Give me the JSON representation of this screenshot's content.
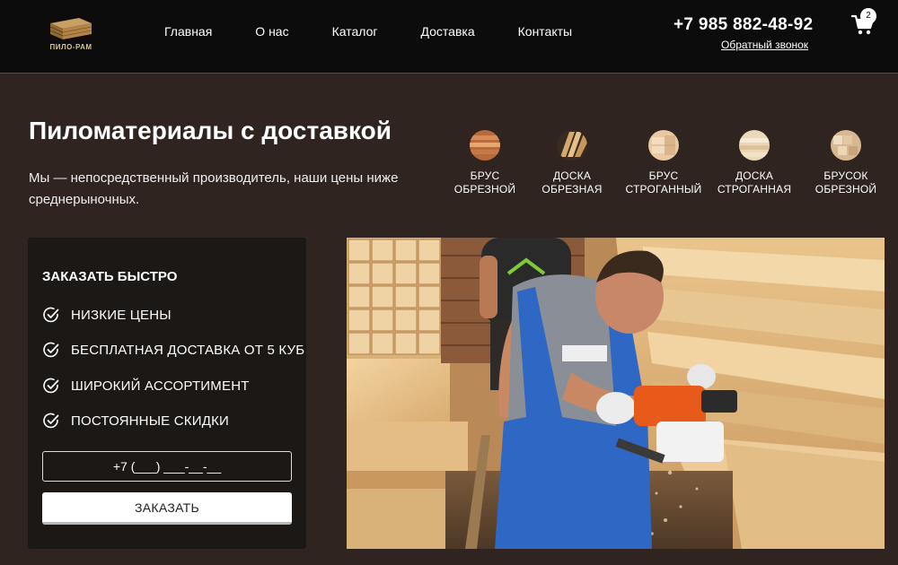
{
  "header": {
    "logo_text": "ПИЛО-РАМ",
    "nav": [
      "Главная",
      "О нас",
      "Каталог",
      "Доставка",
      "Контакты"
    ],
    "phone": "+7 985 882-48-92",
    "callback": "Обратный звонок",
    "cart_count": "2"
  },
  "hero": {
    "title": "Пиломатериалы с доставкой",
    "subtitle": "Мы — непосредственный производитель, наши цены ниже среднерыночных."
  },
  "categories": [
    {
      "line1": "Брус",
      "line2": "обрезной"
    },
    {
      "line1": "Доска",
      "line2": "обрезная"
    },
    {
      "line1": "Брус",
      "line2": "строганный"
    },
    {
      "line1": "Доска",
      "line2": "строганная"
    },
    {
      "line1": "Брусок",
      "line2": "обрезной"
    }
  ],
  "order": {
    "title": "ЗАКАЗАТЬ БЫСТРО",
    "features": [
      "НИЗКИЕ ЦЕНЫ",
      "БЕСПЛАТНАЯ ДОСТАВКА ОТ 5 КУБ",
      "ШИРОКИЙ АССОРТИМЕНТ",
      "ПОСТОЯННЫЕ СКИДКИ"
    ],
    "phone_placeholder": "+7 (___) ___-__-__",
    "button": "ЗАКАЗАТЬ"
  },
  "colors": {
    "header_bg": "#0c0c0c",
    "page_bg": "#2f2420",
    "panel_bg": "#1c1815",
    "wood": "#d9b27a"
  },
  "icons": {
    "cart": "cart-icon",
    "check": "check-circle-icon",
    "logo": "lumber-stack-logo"
  }
}
